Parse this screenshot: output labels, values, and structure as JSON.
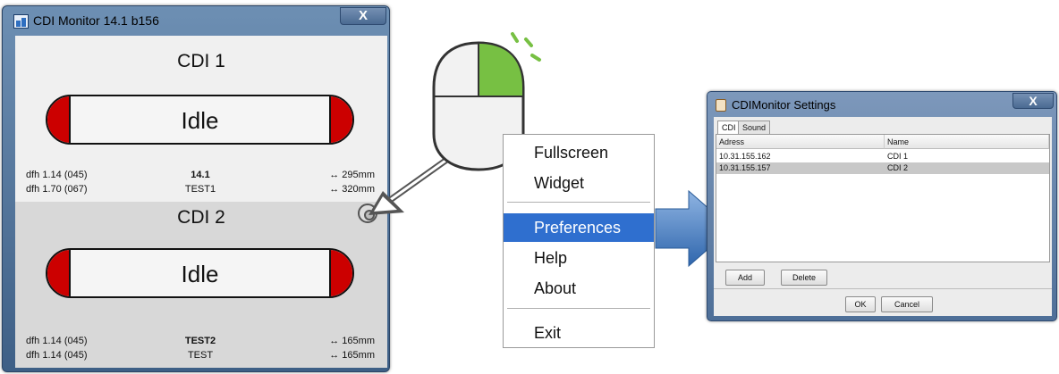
{
  "monitor": {
    "title": "CDI Monitor 14.1 b156",
    "close_label": "X",
    "panels": [
      {
        "name": "CDI 1",
        "state": "Idle",
        "rows": [
          {
            "left": "dfh 1.14 (045)",
            "center": "14.1",
            "right": "↔ 295mm"
          },
          {
            "left": "dfh 1.70 (067)",
            "center": "TEST1",
            "right": "↔ 320mm"
          }
        ]
      },
      {
        "name": "CDI 2",
        "state": "Idle",
        "rows": [
          {
            "left": "dfh 1.14 (045)",
            "center": "TEST2",
            "right": "↔ 165mm"
          },
          {
            "left": "dfh 1.14 (045)",
            "center": "TEST",
            "right": "↔ 165mm"
          }
        ]
      }
    ]
  },
  "menu": {
    "items": [
      "Fullscreen",
      "Widget",
      "Preferences",
      "Help",
      "About",
      "Exit"
    ],
    "selected": "Preferences"
  },
  "settings": {
    "title": "CDIMonitor Settings",
    "close_label": "X",
    "tabs": [
      "CDI",
      "Sound"
    ],
    "columns": [
      "Adress",
      "Name"
    ],
    "rows": [
      {
        "address": "10.31.155.162",
        "name": "CDI 1"
      },
      {
        "address": "10.31.155.157",
        "name": "CDI 2"
      }
    ],
    "add_label": "Add",
    "delete_label": "Delete",
    "ok_label": "OK",
    "cancel_label": "Cancel"
  },
  "colors": {
    "stop_red": "#cc0000",
    "menu_highlight": "#2f6fcf",
    "mouse_button_green": "#77c043",
    "arrow_blue": "#3e78c0"
  }
}
